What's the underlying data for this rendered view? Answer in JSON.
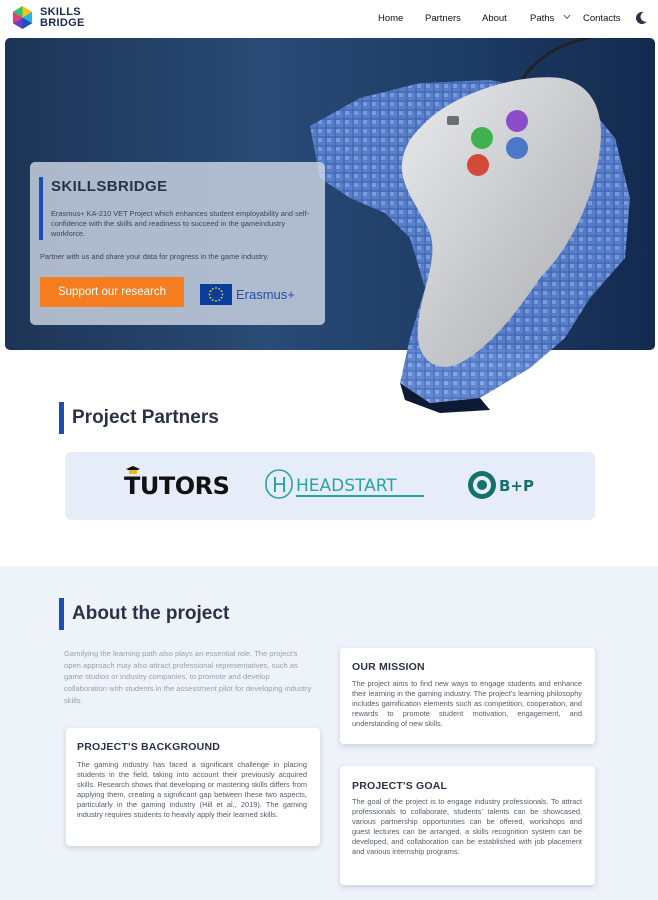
{
  "brand": {
    "line1": "SKILLS",
    "line2": "BRIDGE"
  },
  "nav": {
    "items": [
      {
        "label": "Home"
      },
      {
        "label": "Partners"
      },
      {
        "label": "About"
      },
      {
        "label": "Paths"
      },
      {
        "label": "Contacts"
      }
    ]
  },
  "hero": {
    "title": "SKILLSBRIDGE",
    "description": "Erasmus+ KA-210 VET Project which enhances student employability and self-confidence with the skills and readiness to succeed in the gameindustry workforce.",
    "partner_line": "Partner with us and share your data for progress in the game industry.",
    "cta_label": "Support our research",
    "erasmus_label": "Erasmus+"
  },
  "partners": {
    "title": "Project Partners",
    "logos": [
      {
        "name": "TUTORS"
      },
      {
        "name": "HEADSTART"
      },
      {
        "name": "B+P"
      }
    ]
  },
  "about": {
    "title": "About the project",
    "intro": "Gamifying the learning path also plays an essential role. The project's open approach may also attract professional representatives, such as game studios or industry companies, to promote and develop collaboration with students in the assessment pilot for developing industry skills.",
    "background": {
      "title": "PROJECT'S BACKGROUND",
      "text": "The gaming industry has faced a significant challenge in placing students in the field, taking into account their previously acquired skills. Research shows that developing or mastering skills differs from applying them, creating a significant gap between these two aspects, particularly in the gaming industry (Hill et al., 2019). The gaming industry requires students to heavily apply their learned skills."
    },
    "mission": {
      "title": "OUR MISSION",
      "text": "The project aims to find new ways to engage students and enhance their learning in the gaming industry. The project's learning philosophy includes gamification elements such as competition, cooperation, and rewards to promote student motivation, engagement, and understanding of new skills."
    },
    "goal": {
      "title": "PROJECT'S GOAL",
      "text": "The goal of the project is to engage industry professionals. To attract professionals to collaborate, students' talents can be showcased, various partnership opportunities can be offered, workshops and guest lectures can be arranged, a skills recognition system can be developed, and collaboration can be established with job placement and various internship programs."
    }
  },
  "colors": {
    "accent": "#1a4eb8",
    "cta": "#f47d1f",
    "hero_bg": "#1d3456",
    "text_dark": "#2a3346"
  }
}
